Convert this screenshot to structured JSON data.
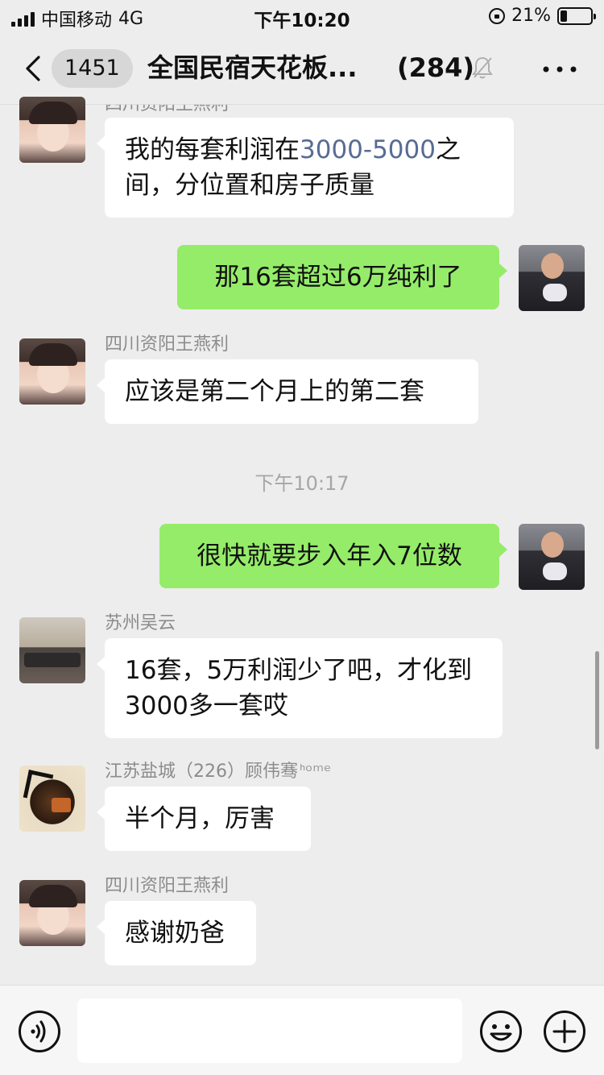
{
  "status_bar": {
    "carrier": "中国移动",
    "network": "4G",
    "time": "下午10:20",
    "battery": "21%",
    "battery_level": 0.21
  },
  "nav": {
    "back_count": "1451",
    "title": "全国民宿天花板...",
    "member_count": "(284)"
  },
  "messages": [
    {
      "sender": "四川资阳王燕利",
      "text_pre": "我的每套利润在",
      "text_hl": "3000-5000",
      "text_post": "之间，分位置和房子质量"
    },
    {
      "out_text": "那16套超过6万纯利了"
    },
    {
      "sender": "四川资阳王燕利",
      "text": "应该是第二个月上的第二套"
    },
    {
      "timestamp": "下午10:17"
    },
    {
      "out_text": "很快就要步入年入7位数"
    },
    {
      "sender": "苏州吴云",
      "text": "16套，5万利润少了吧，才化到3000多一套哎"
    },
    {
      "sender": "江苏盐城（226）顾伟骞",
      "sender_suffix": "ᑋᵒᵐᵉ",
      "text": "半个月，厉害"
    },
    {
      "sender": "四川资阳王燕利",
      "text": "感谢奶爸"
    }
  ],
  "input_bar": {
    "placeholder": ""
  }
}
